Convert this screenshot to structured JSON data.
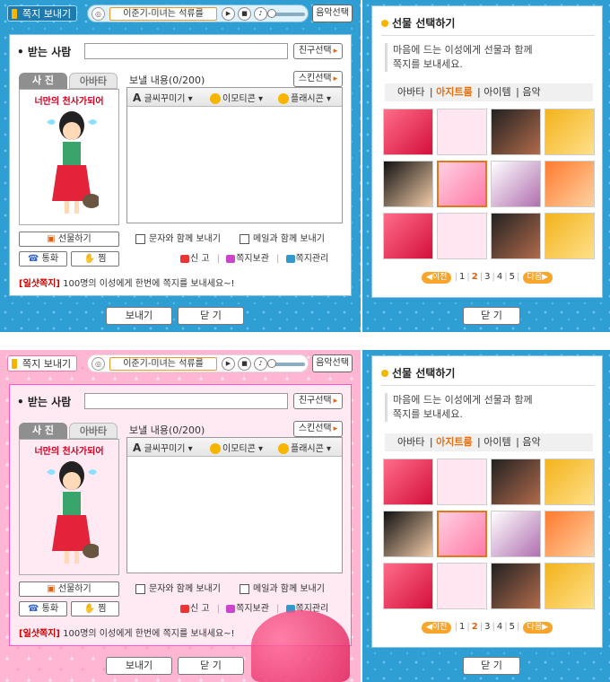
{
  "compose": {
    "title": "쪽지 보내기",
    "song": "이준기-미녀는 석류를",
    "music_select": "음악선택",
    "recipient_label": "받는 사람",
    "friend_select": "친구선택",
    "tabs": [
      "사 진",
      "아바타"
    ],
    "avatar_caption": "너만의 천사가되어",
    "message_label": "보낼 내용(0/200)",
    "skin_select": "스킨선택",
    "tools": {
      "font": "글씨꾸미기",
      "emoticon": "이모티콘",
      "flash": "플래시콘"
    },
    "gift_button": "선물하기",
    "call_button": "통화",
    "zzim_button": "찜",
    "send_with_sms": "문자와 함께 보내기",
    "send_with_mail": "메일과 함께 보내기",
    "links": {
      "report": "신 고",
      "archive": "쪽지보관",
      "manage": "쪽지관리"
    },
    "notice_tag": "[일샷쪽지]",
    "notice_text": "100명의 이성에게 한번에 쪽지를 보내세요~!",
    "send": "보내기",
    "close": "닫 기"
  },
  "gift": {
    "title": "선물 선택하기",
    "desc_line1": "마음에 드는 이성에게 선물과 함께",
    "desc_line2": "쪽지를 보내세요.",
    "tabs": [
      "아바타",
      "아지트룸",
      "아이템",
      "음악"
    ],
    "active_tab": "아지트룸",
    "prev": "◀이전",
    "pages": [
      "1",
      "2",
      "3",
      "4",
      "5"
    ],
    "current_page": "2",
    "next": "다음▶",
    "close": "닫 기"
  },
  "colors": {
    "accent": "#e6700d",
    "blue_frame": "#2f9fd3",
    "pink_frame": "#ffb6d2"
  }
}
